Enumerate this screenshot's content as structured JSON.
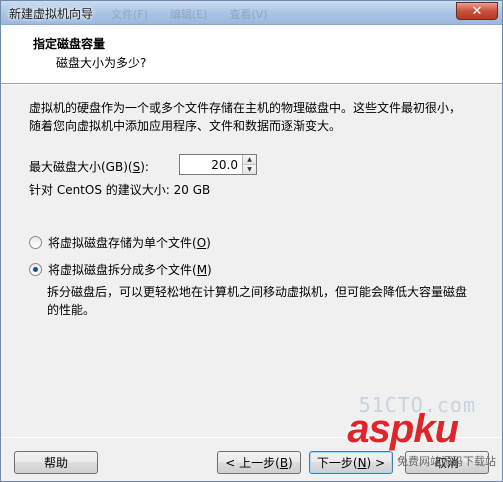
{
  "window": {
    "title": "新建虚拟机向导",
    "ghost_menu": [
      "文件(F)",
      "编辑(E)",
      "查看(V)"
    ],
    "close_glyph": "✕"
  },
  "header": {
    "title": "指定磁盘容量",
    "subtitle": "磁盘大小为多少?"
  },
  "body": {
    "description": "虚拟机的硬盘作为一个或多个文件存储在主机的物理磁盘中。这些文件最初很小，随着您向虚拟机中添加应用程序、文件和数据而逐渐变大。",
    "max_size_label_prefix": "最大磁盘大小(GB)(",
    "max_size_label_key": "S",
    "max_size_label_suffix": "):",
    "max_size_value": "20.0",
    "recommended": "针对 CentOS 的建议大小: 20 GB",
    "options": [
      {
        "prefix": "将虚拟磁盘存储为单个文件(",
        "key": "O",
        "suffix": ")",
        "checked": false
      },
      {
        "prefix": "将虚拟磁盘拆分成多个文件(",
        "key": "M",
        "suffix": ")",
        "checked": true
      }
    ],
    "split_description": "拆分磁盘后，可以更轻松地在计算机之间移动虚拟机，但可能会降低大容量磁盘的性能。"
  },
  "footer": {
    "help": "帮助",
    "back_prefix": "< 上一步(",
    "back_key": "B",
    "back_suffix": ")",
    "next_prefix": "下一步(",
    "next_key": "N",
    "next_suffix": ") >",
    "cancel": "取消"
  },
  "watermark": {
    "top": "51CTO.com",
    "brand": "aspku",
    "sub": "免费网站源码下载站"
  },
  "colors": {
    "accent": "#3c7fb1",
    "watermark_red": "#e0242a"
  }
}
